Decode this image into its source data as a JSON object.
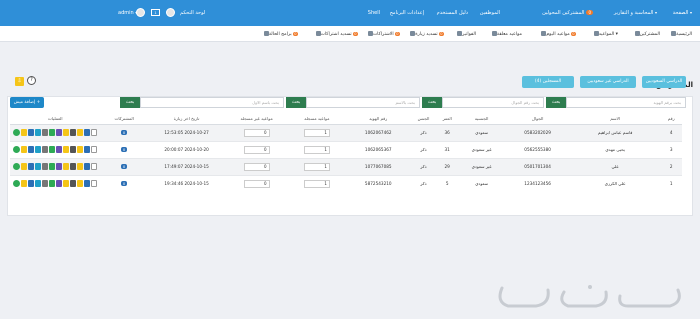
{
  "topnav": {
    "home": "الصفحة",
    "accounting": "المحاسبة و التقارير",
    "sales_agents": "المشتركين المحولين",
    "sales_agents_badge": "0",
    "employees": "الموظفين",
    "users": "دليل المستخدم",
    "settings": "إعدادات البرنامج",
    "shell": "Shell",
    "dashboard": "لوحة التحكم",
    "admin": "admin",
    "badge_a": "1"
  },
  "subnav": {
    "items": [
      {
        "label": "الرئيسية"
      },
      {
        "label": "المشتركين"
      },
      {
        "label": "المواعيد",
        "badge": ""
      },
      {
        "label": "مواعيد اليوم",
        "badge": "0"
      },
      {
        "label": "مواعيد معلقة"
      },
      {
        "label": "الفواتير"
      },
      {
        "label": "تسديد زيارة",
        "badge": "0"
      },
      {
        "label": "الاشتراكات",
        "badge": "0"
      },
      {
        "label": "تسديد اشتراكات",
        "badge": "0"
      },
      {
        "label": "برامج الحالة",
        "badge": "0"
      }
    ]
  },
  "page": {
    "title": "المشتركين"
  },
  "toolbar": {
    "filter_buttons": [
      "الدراسي السعوديين",
      "الدراسي غير سعوديين",
      "المسجلين (4)"
    ],
    "help_label": "?",
    "add_button": "إضافة ميش +"
  },
  "search": {
    "placeholders": [
      "بحث برقم الهوية",
      "بحث رقم الجوال",
      "بحث بالاسم",
      "بحث باسم الاول"
    ],
    "button_label": "بحث"
  },
  "table": {
    "headers": [
      "رقم",
      "الاسم",
      "الجوال",
      "الجنسية",
      "العمر",
      "الجنس",
      "رقم الهوية",
      "مواعيد مسجلة",
      "مواعيد غير مسجلة",
      "تاريخ اخر زيارة",
      "المشتركات",
      "العمليات"
    ],
    "rows": [
      {
        "no": "4",
        "name": "قاسم عباس ابراهيم",
        "phone": "0583202029",
        "nationality": "سعودي",
        "age": "36",
        "gender": "ذكر",
        "id_no": "1062067462",
        "registered": "1",
        "unregistered": "0",
        "last_visit": "12:53:05 2024-10-27",
        "subs": "0"
      },
      {
        "no": "3",
        "name": "يحيى مهدي",
        "phone": "0562555380",
        "nationality": "غير سعودي",
        "age": "31",
        "gender": "ذكر",
        "id_no": "1062065367",
        "registered": "1",
        "unregistered": "0",
        "last_visit": "20:00:07 2024-10-20",
        "subs": "0"
      },
      {
        "no": "2",
        "name": "علي",
        "phone": "0501701304",
        "nationality": "غير سعودي",
        "age": "29",
        "gender": "ذكر",
        "id_no": "1077067085",
        "registered": "1",
        "unregistered": "0",
        "last_visit": "17:49:07 2024-10-15",
        "subs": "0"
      },
      {
        "no": "1",
        "name": "علي الكرزي",
        "phone": "1234123456",
        "nationality": "سعودي",
        "age": "5",
        "gender": "ذكر",
        "id_no": "5872543210",
        "registered": "1",
        "unregistered": "0",
        "last_visit": "19:34:46 2024-10-15",
        "subs": "0"
      }
    ]
  },
  "colors": {
    "nav": "#2f8fd8",
    "teal": "#5bc0de",
    "green": "#2e7d4f",
    "add": "#1e88c8",
    "badge": "#f07a2a"
  },
  "watermark": {
    "text": "حراج"
  }
}
